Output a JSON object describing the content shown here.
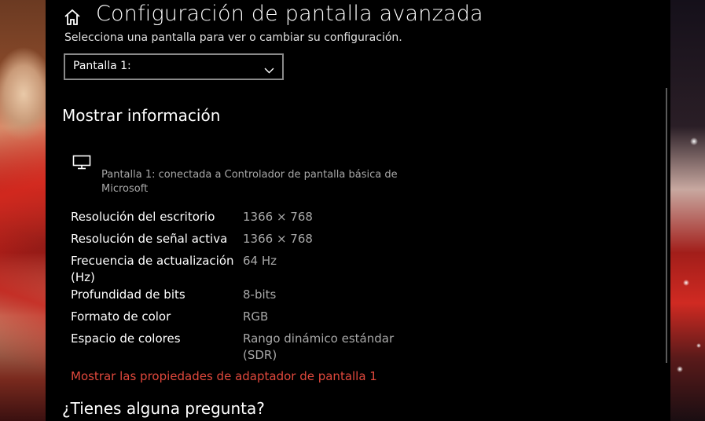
{
  "page": {
    "title": "Configuración de pantalla avanzada",
    "select_hint": "Selecciona una pantalla para ver o cambiar su configuración."
  },
  "display_select": {
    "value": "Pantalla 1:",
    "icon": "chevron-down-icon"
  },
  "display_info": {
    "title": "Mostrar información",
    "icon": "monitor-icon",
    "description": "Pantalla 1: conectada a Controlador de pantalla básica de Microsoft",
    "rows": [
      {
        "label": "Resolución del escritorio",
        "value": "1366 × 768"
      },
      {
        "label": "Resolución de señal activa",
        "value": "1366 × 768"
      },
      {
        "label": "Frecuencia de actualización (Hz)",
        "value": "64 Hz"
      },
      {
        "label": "Profundidad de bits",
        "value": "8-bits"
      },
      {
        "label": "Formato de color",
        "value": "RGB"
      },
      {
        "label": "Espacio de colores",
        "value": "Rango dinámico estándar (SDR)"
      }
    ],
    "adapter_link": "Mostrar las propiedades de adaptador de pantalla 1"
  },
  "help": {
    "title": "¿Tienes alguna pregunta?"
  },
  "colors": {
    "background": "#000000",
    "text": "#ffffff",
    "secondary_text": "#a8a8a8",
    "link": "#e0483c"
  }
}
